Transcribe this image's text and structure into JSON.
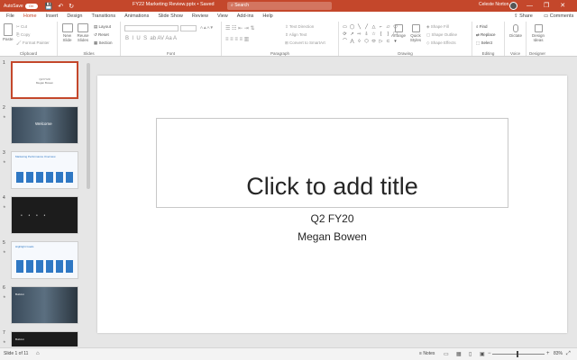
{
  "titlebar": {
    "autosave_label": "AutoSave",
    "autosave_state": "On",
    "doc_title": "FY22 Marketing Review.pptx",
    "saved_status": "Saved",
    "search_placeholder": "Search",
    "user_name": "Celeste Norton",
    "qat": {
      "save_icon": "💾",
      "undo_icon": "↶",
      "redo_icon": "↻"
    },
    "window": {
      "minimize": "—",
      "restore": "❐",
      "close": "✕"
    }
  },
  "tabs": [
    "File",
    "Home",
    "Insert",
    "Design",
    "Transitions",
    "Animations",
    "Slide Show",
    "Review",
    "View",
    "Add-ins",
    "Help"
  ],
  "active_tab": "Home",
  "share_label": "Share",
  "comments_label": "Comments",
  "ribbon": {
    "clipboard": {
      "paste": "Paste",
      "cut": "Cut",
      "copy": "Copy",
      "format_painter": "Format Painter",
      "label": "Clipboard"
    },
    "slides": {
      "new_slide": "New Slide",
      "reuse_slides": "Reuse Slides",
      "layout": "Layout",
      "reset": "Reset",
      "section": "Section",
      "label": "Slides"
    },
    "font": {
      "label": "Font",
      "bold": "B",
      "italic": "I",
      "underline": "U",
      "strike": "S"
    },
    "paragraph": {
      "label": "Paragraph",
      "text_direction": "Text Direction",
      "align_text": "Align Text",
      "smartart": "Convert to SmartArt"
    },
    "drawing": {
      "label": "Drawing",
      "arrange": "Arrange",
      "quick_styles": "Quick Styles",
      "shape_fill": "Shape Fill",
      "shape_outline": "Shape Outline",
      "shape_effects": "Shape Effects"
    },
    "editing": {
      "label": "Editing",
      "find": "Find",
      "replace": "Replace",
      "select": "Select"
    },
    "voice": {
      "label": "Voice",
      "dictate": "Dictate"
    },
    "designer": {
      "label": "Designer",
      "design_ideas": "Design Ideas"
    }
  },
  "thumbnails": [
    {
      "num": "1",
      "kind": "title",
      "line1": "Q2 FY20",
      "line2": "Megan Bowen"
    },
    {
      "num": "2",
      "kind": "photo",
      "text": "Welcome"
    },
    {
      "num": "3",
      "kind": "blue",
      "text": "Marketing Performance Overview"
    },
    {
      "num": "4",
      "kind": "dark",
      "text": ""
    },
    {
      "num": "5",
      "kind": "blue",
      "text": "Highlight Goals"
    },
    {
      "num": "6",
      "kind": "photo",
      "text": "Build-in"
    },
    {
      "num": "7",
      "kind": "dark",
      "text": "Build-in"
    }
  ],
  "slide": {
    "title_placeholder": "Click to add title",
    "subtitle_line1": "Q2 FY20",
    "subtitle_line2": "Megan Bowen"
  },
  "status": {
    "slide_count": "Slide 1 of 11",
    "notes": "Notes",
    "zoom": "83%"
  }
}
